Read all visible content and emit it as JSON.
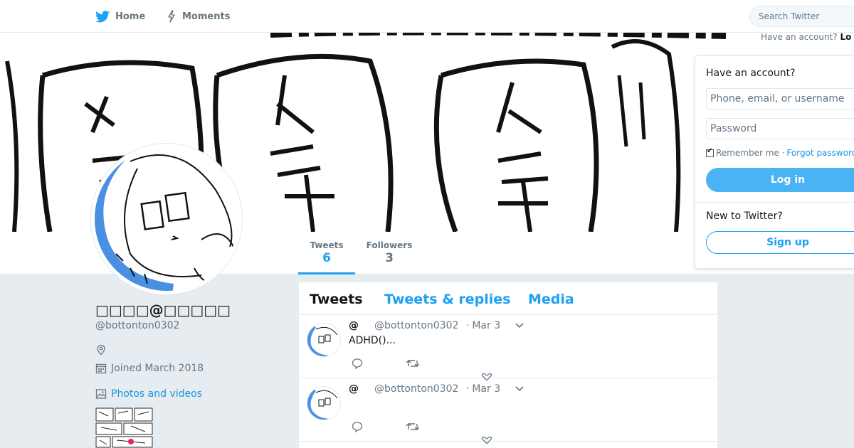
{
  "nav": {
    "home_label": "Home",
    "moments_label": "Moments",
    "search_placeholder": "Search Twitter",
    "have_account_text": "Have an account?",
    "login_link_text": "Lo"
  },
  "profile": {
    "name": "□□□□@□□□□□",
    "handle": "@bottonton0302",
    "joined": "Joined March 2018",
    "photos_label": "Photos and videos"
  },
  "stats": {
    "tweets_label": "Tweets",
    "tweets_value": "6",
    "followers_label": "Followers",
    "followers_value": "3"
  },
  "timeline": {
    "tabs": [
      {
        "label": "Tweets"
      },
      {
        "label": "Tweets & replies"
      },
      {
        "label": "Media"
      }
    ],
    "tweets": [
      {
        "fullname": "@",
        "handle": "@bottonton0302",
        "time": "· Mar 3",
        "text": "ADHD()..."
      },
      {
        "fullname": "@",
        "handle": "@bottonton0302",
        "time": "· Mar 3",
        "text": ""
      }
    ]
  },
  "login": {
    "title": "Have an account?",
    "username_placeholder": "Phone, email, or username",
    "password_placeholder": "Password",
    "remember_label": "Remember me",
    "separator": "·",
    "forgot_label": "Forgot password?",
    "login_button": "Log in",
    "new_title": "New to Twitter?",
    "signup_button": "Sign up"
  },
  "colors": {
    "accent": "#1da1f2",
    "login_button": "#4ab3f4",
    "background": "#e6ecf0"
  }
}
